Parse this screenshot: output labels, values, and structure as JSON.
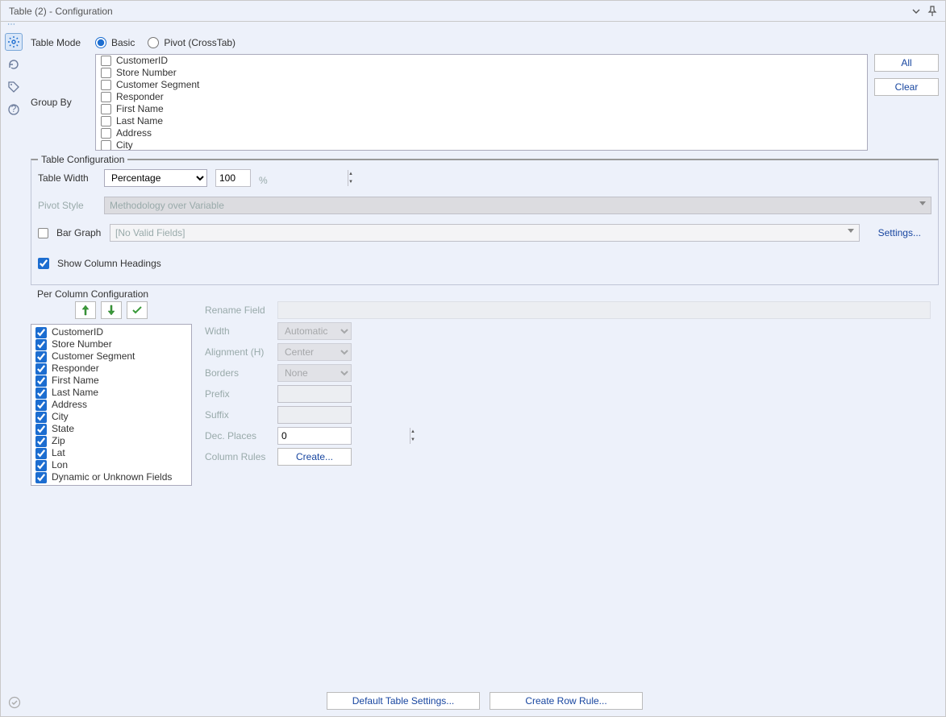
{
  "window": {
    "title": "Table (2) - Configuration"
  },
  "topLabels": {
    "tableMode": "Table Mode",
    "groupBy": "Group By"
  },
  "tableMode": {
    "basic": "Basic",
    "pivot": "Pivot (CrossTab)",
    "selected": "basic"
  },
  "groupByFields": [
    "CustomerID",
    "Store Number",
    "Customer Segment",
    "Responder",
    "First Name",
    "Last Name",
    "Address",
    "City"
  ],
  "sideButtons": {
    "all": "All",
    "clear": "Clear"
  },
  "tableConfig": {
    "legend": "Table Configuration",
    "tableWidthLabel": "Table Width",
    "tableWidthMode": "Percentage",
    "tableWidthValue": "100",
    "percentSign": "%",
    "pivotStyleLabel": "Pivot Style",
    "pivotStylePlaceholder": "Methodology over Variable",
    "barGraphLabel": "Bar Graph",
    "barGraphPlaceholder": "[No Valid Fields]",
    "settings": "Settings...",
    "showHeadings": "Show Column Headings"
  },
  "perColumn": {
    "legend": "Per Column Configuration",
    "fields": [
      "CustomerID",
      "Store Number",
      "Customer Segment",
      "Responder",
      "First Name",
      "Last Name",
      "Address",
      "City",
      "State",
      "Zip",
      "Lat",
      "Lon",
      "Dynamic or Unknown Fields"
    ],
    "labels": {
      "rename": "Rename Field",
      "width": "Width",
      "alignment": "Alignment (H)",
      "borders": "Borders",
      "prefix": "Prefix",
      "suffix": "Suffix",
      "decPlaces": "Dec. Places",
      "columnRules": "Column Rules"
    },
    "values": {
      "width": "Automatic",
      "alignment": "Center",
      "borders": "None",
      "decPlaces": "0",
      "createBtn": "Create..."
    }
  },
  "footer": {
    "defaultSettings": "Default Table Settings...",
    "createRowRule": "Create Row Rule..."
  }
}
